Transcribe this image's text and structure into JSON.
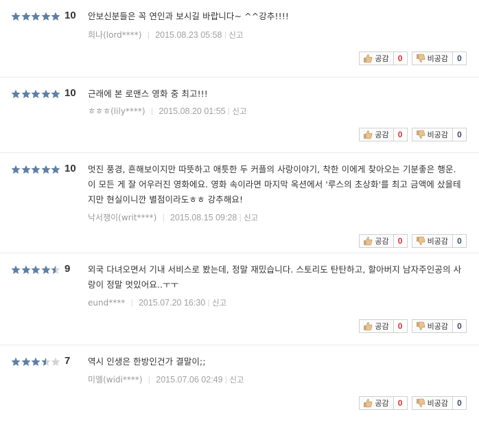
{
  "labels": {
    "like": "공감",
    "dislike": "비공감",
    "report": "신고"
  },
  "colors": {
    "star_on": "#5f7fa6",
    "star_off": "#d4d4d4",
    "like_count": "#e12c2c",
    "dislike_count": "#3a4b73"
  },
  "icons": {
    "star": "star-icon",
    "like": "thumbs-up-icon",
    "dislike": "thumbs-down-icon"
  },
  "reviews": [
    {
      "rating": 5,
      "score": "10",
      "text": "안보신분들은 꼭 연인과 보시길 바랍니다~ ^^강추!!!!",
      "user": "희나(lord****)",
      "date": "2015.08.23 05:58",
      "likes": "0",
      "dislikes": "0"
    },
    {
      "rating": 5,
      "score": "10",
      "text": "근래에 본 로맨스 영화 중 최고!!!",
      "user": "ㅎㅎㅎ(lily****)",
      "date": "2015.08.20 01:55",
      "likes": "0",
      "dislikes": "0"
    },
    {
      "rating": 5,
      "score": "10",
      "text": "멋진 풍경, 흔해보이지만 따뜻하고 애틋한 두 커플의 사랑이야기, 착한 이에게 찾아오는 기분좋은 행운. 이 모든 게 잘 어우러진 영화에요. 영화 속이라면 마지막 옥션에서 '루스의 초상화'를 최고 금액에 샀을테지만 현실이니깐 별점이라도ㅎㅎ 강추해요!",
      "user": "낙서쟁이(writ****)",
      "date": "2015.08.15 09:28",
      "likes": "0",
      "dislikes": "0"
    },
    {
      "rating": 4.5,
      "score": "9",
      "text": "외국 다녀오면서 기내 서비스로 봤는데, 정말 재밌습니다. 스토리도 탄탄하고, 할아버지 남자주인공의 사랑이 정말 멋있어요..ㅜㅜ",
      "user": "eund****",
      "date": "2015.07.20 16:30",
      "likes": "0",
      "dislikes": "0"
    },
    {
      "rating": 3.5,
      "score": "7",
      "text": "역시 인생은 한방인건가 결말이;;",
      "user": "미엘(widi****)",
      "date": "2015.07.06 02:49",
      "likes": "0",
      "dislikes": "0"
    }
  ]
}
